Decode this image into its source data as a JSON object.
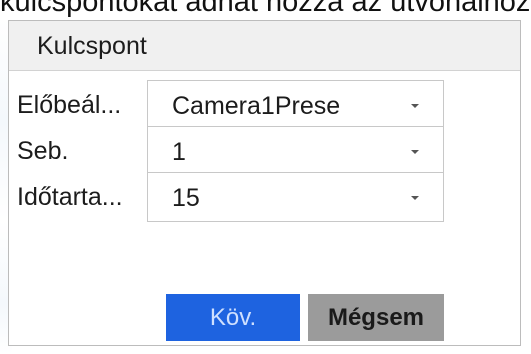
{
  "heading_partial": "kulcspontokat adhat hozzá az útvonalhoz",
  "dialog": {
    "title": "Kulcspont"
  },
  "fields": [
    {
      "label": "Előbeál...",
      "value": "Camera1Prese"
    },
    {
      "label": "Seb.",
      "value": "1"
    },
    {
      "label": "Időtarta...",
      "value": "15"
    }
  ],
  "buttons": {
    "next": "Köv.",
    "cancel": "Mégsem"
  },
  "colors": {
    "primary": "#1e63e0",
    "secondary": "#9b9b9b",
    "header_bg": "#f0f0f0"
  }
}
